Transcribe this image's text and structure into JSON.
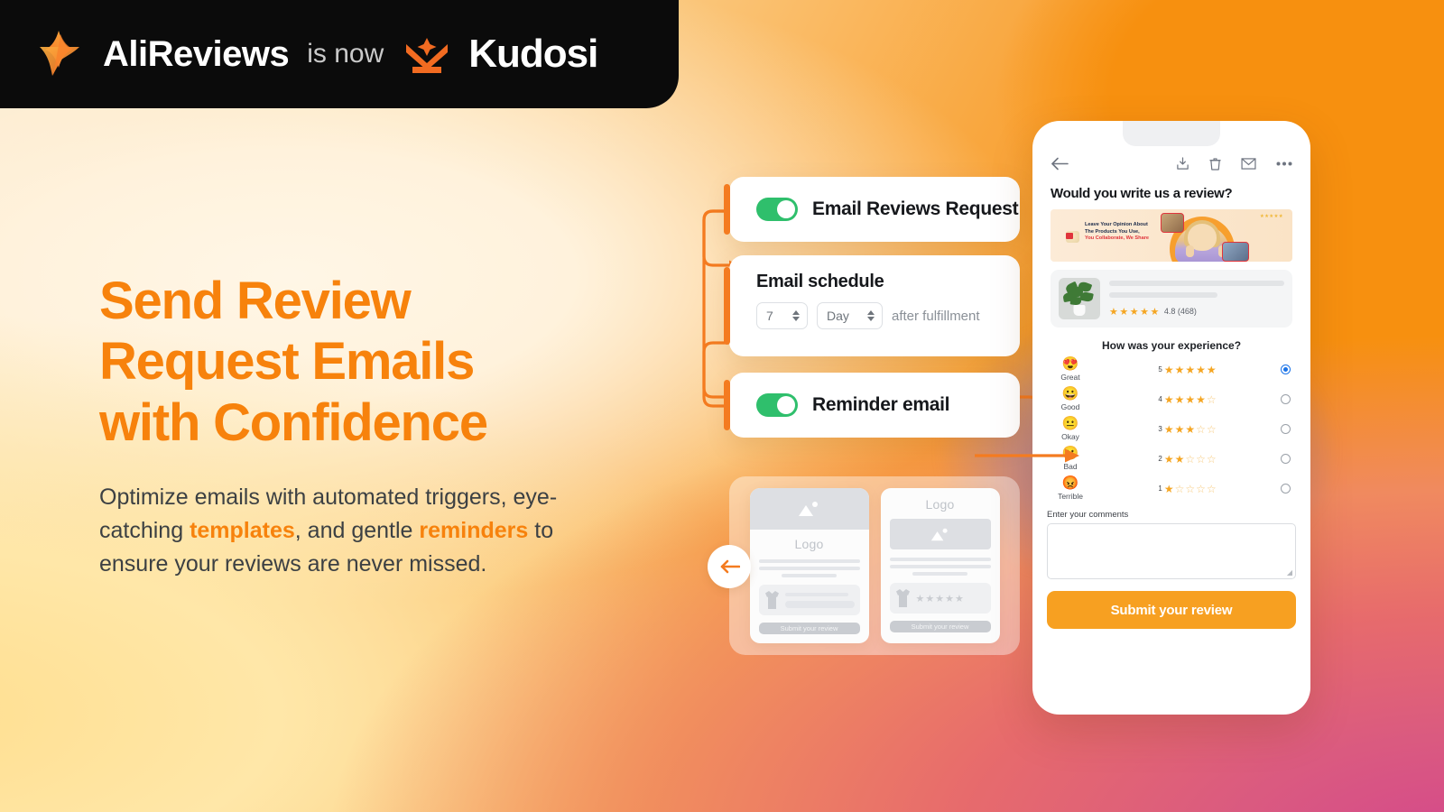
{
  "brand": {
    "ali_name": "AliReviews",
    "connector": "is now",
    "kudosi_name": "Kudosi",
    "ali_star_icon": "ali-star-icon",
    "kudosi_crown_icon": "kudosi-crown-icon"
  },
  "hero": {
    "headline_line1": "Send Review",
    "headline_line2": "Request Emails",
    "headline_line3": "with Confidence",
    "sub_part1": "Optimize emails with automated triggers, eye-catching ",
    "sub_highlight1": "templates",
    "sub_part2": ", and gentle ",
    "sub_highlight2": "reminders",
    "sub_part3": " to ensure your reviews are never missed.",
    "headline_color": "#F7820C",
    "body_color": "#3C4043"
  },
  "settings": {
    "email_reviews_request": {
      "label": "Email Reviews Request",
      "toggle_state": "on"
    },
    "email_schedule": {
      "title": "Email schedule",
      "delay_value": "7",
      "unit_value": "Day",
      "suffix": "after fulfillment"
    },
    "reminder_email": {
      "label": "Reminder email",
      "toggle_state": "on"
    },
    "toggle_on_color": "#2FBF6C",
    "accent_color": "#F47B20"
  },
  "templates": {
    "back_arrow_icon": "arrow-left-icon",
    "card_left": {
      "logo_label": "Logo",
      "submit_label": "Submit your review",
      "image_icon": "image-placeholder-icon"
    },
    "card_right": {
      "logo_label": "Logo",
      "submit_label": "Submit your review",
      "image_icon": "image-placeholder-icon",
      "stars": "★★★★★"
    }
  },
  "phone": {
    "toolbar": {
      "back_icon": "arrow-left-icon",
      "archive_icon": "archive-download-icon",
      "delete_icon": "trash-icon",
      "mail_icon": "envelope-icon",
      "more_icon": "more-horizontal-icon"
    },
    "email_subject": "Would you write us a review?",
    "banner": {
      "line1": "Leave Your Opinion About",
      "line2": "The Products You Use,",
      "line3": "You Collaborate, We Share",
      "stars": "★★★★★",
      "bg_color": "#FBE6CC"
    },
    "product": {
      "image_alt": "potted-plant-product-image",
      "rating_stars": "★★★★★",
      "rating_score": "4.8 (468)"
    },
    "experience_question": "How was your experience?",
    "rating_options": [
      {
        "emoji": "😍",
        "label": "Great",
        "number": "5",
        "filled": 5,
        "selected": true
      },
      {
        "emoji": "😀",
        "label": "Good",
        "number": "4",
        "filled": 4,
        "selected": false
      },
      {
        "emoji": "😐",
        "label": "Okay",
        "number": "3",
        "filled": 3,
        "selected": false
      },
      {
        "emoji": "🙁",
        "label": "Bad",
        "number": "2",
        "filled": 2,
        "selected": false
      },
      {
        "emoji": "😡",
        "label": "Terrible",
        "number": "1",
        "filled": 1,
        "selected": false
      }
    ],
    "comments_label": "Enter your comments",
    "comments_value": "",
    "comments_placeholder": "",
    "submit_label": "Submit your review",
    "submit_color": "#F7A021",
    "selected_radio_color": "#1A73E8",
    "star_color": "#F5A623"
  },
  "background": {
    "orange": "#F7900F",
    "cream": "#FBE9CF",
    "yellow": "#FBD79B",
    "pink": "#D4488C",
    "purple": "#8474BE"
  }
}
